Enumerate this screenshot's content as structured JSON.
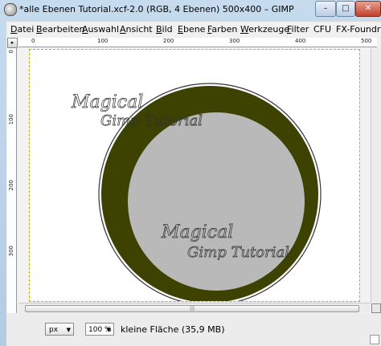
{
  "window": {
    "title": "*alle Ebenen Tutorial.xcf-2.0 (RGB, 4 Ebenen) 500x400 – GIMP",
    "buttons": {
      "minimize": "–",
      "maximize": "□",
      "close": "✕"
    }
  },
  "menubar": {
    "items": [
      {
        "u": "D",
        "rest": "atei"
      },
      {
        "u": "B",
        "rest": "earbeiten"
      },
      {
        "u": "A",
        "rest": "uswahl"
      },
      {
        "u": "A",
        "rest": "nsicht"
      },
      {
        "u": "B",
        "rest": "ild"
      },
      {
        "u": "E",
        "rest": "bene"
      },
      {
        "u": "F",
        "rest": "arben"
      },
      {
        "u": "W",
        "rest": "erkzeuge"
      },
      {
        "u": "F",
        "rest": "ilter"
      },
      {
        "u": "",
        "rest": "CFU"
      },
      {
        "u": "",
        "rest": "FX-Foundry"
      }
    ]
  },
  "rulers": {
    "horizontal": [
      "0",
      "100",
      "200",
      "300",
      "400",
      "500"
    ],
    "vertical": [
      "0",
      "100",
      "200",
      "300"
    ]
  },
  "canvas": {
    "watermark": {
      "line1": "Magical",
      "line2": "Gimp Tutorial"
    },
    "colors": {
      "ring": "#3d4200",
      "inner": "#b9b9b9",
      "image_bg": "#ffffff",
      "border": "#b8b800"
    }
  },
  "statusbar": {
    "unit": "px",
    "zoom": "100 %",
    "message": "kleine Fläche (35,9 MB)"
  },
  "scrollbar": {
    "thumb_grip": "|||"
  }
}
